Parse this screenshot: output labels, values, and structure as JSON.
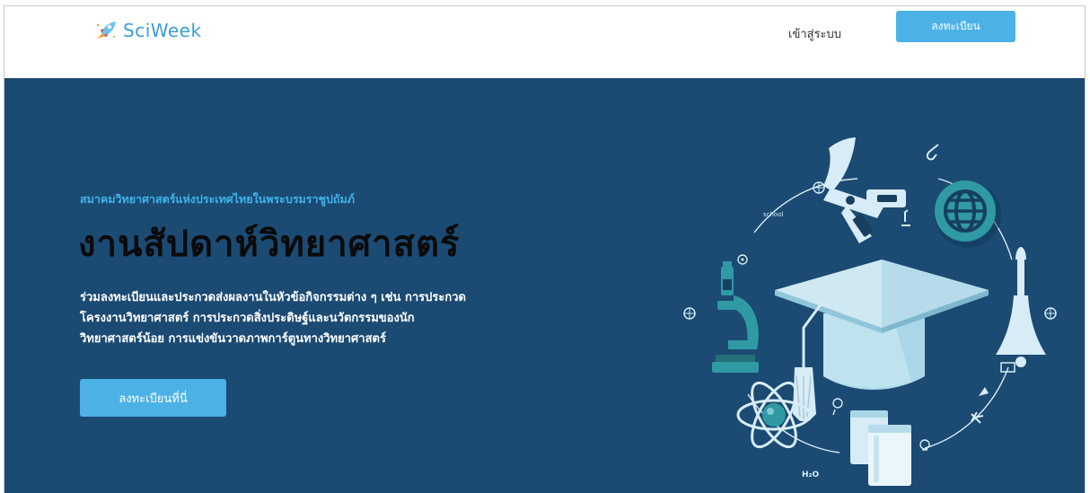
{
  "nav": {
    "brand": "SciWeek",
    "login": "เข้าสู่ระบบ",
    "register": "ลงทะเบียน"
  },
  "hero": {
    "kicker": "สมาคมวิทยาศาสตร์แห่งประเทศไทยในพระบรมราชูปถัมภ์",
    "title": "งานสัปดาห์วิทยาศาสตร์",
    "description": "ร่วมลงทะเบียนและประกวดส่งผลงานในหัวข้อกิจกรรมต่าง ๆ เช่น การประกวดโครงงานวิทยาศาสตร์ การประกวดสิ่งประดิษฐ์และนวัตกรรมของนักวิทยาศาสตร์น้อย การแข่งขันวาดภาพการ์ตูนทางวิทยาศาสตร์",
    "cta": "ลงทะเบียนที่นี่"
  },
  "illustration": {
    "school_label": "school",
    "formula_label": "H₂O"
  },
  "colors": {
    "hero_bg": "#1b4a73",
    "accent": "#4cb2e6",
    "kicker": "#3fb4ea"
  }
}
